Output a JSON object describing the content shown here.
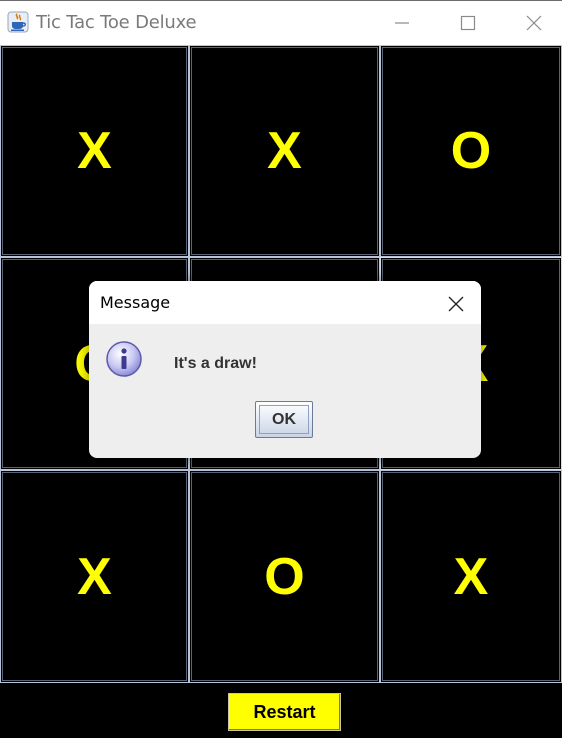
{
  "window": {
    "title": "Tic Tac Toe Deluxe",
    "icon": "java-cup-icon",
    "controls": [
      "minimize",
      "maximize",
      "close"
    ]
  },
  "board": {
    "cells": [
      "X",
      "X",
      "O",
      "O",
      "",
      "X",
      "X",
      "O",
      "X"
    ],
    "mark_color": "#ffff00",
    "background_color": "#000000"
  },
  "restart_button": {
    "label": "Restart",
    "color": "#ffff00"
  },
  "dialog": {
    "title": "Message",
    "icon": "info-icon",
    "message": "It's a draw!",
    "ok_label": "OK"
  }
}
